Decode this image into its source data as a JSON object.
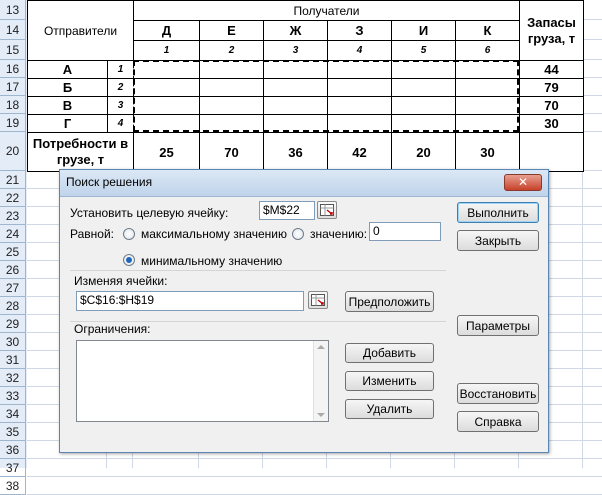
{
  "rows": [
    "13",
    "14",
    "15",
    "16",
    "17",
    "18",
    "19",
    "20",
    "21",
    "22",
    "23",
    "24",
    "25",
    "26",
    "27",
    "28",
    "29",
    "30",
    "31",
    "32",
    "33",
    "34",
    "35",
    "36",
    "37",
    "38"
  ],
  "table": {
    "senders_header": "Отправители",
    "receivers_header": "Получатели",
    "receivers": [
      "Д",
      "Е",
      "Ж",
      "З",
      "И",
      "К"
    ],
    "receiver_numbers": [
      "1",
      "2",
      "3",
      "4",
      "5",
      "6"
    ],
    "stock_header": "Запасы груза, т",
    "senders": [
      {
        "name": "А",
        "num": "1",
        "stock": "44"
      },
      {
        "name": "Б",
        "num": "2",
        "stock": "79"
      },
      {
        "name": "В",
        "num": "3",
        "stock": "70"
      },
      {
        "name": "Г",
        "num": "4",
        "stock": "30"
      }
    ],
    "demand_label": "Потребности в грузе, т",
    "demand": [
      "25",
      "70",
      "36",
      "42",
      "20",
      "30"
    ]
  },
  "dialog": {
    "title": "Поиск решения",
    "close_label": "✕",
    "target_label": "Установить целевую ячейку:",
    "target_value": "$M$22",
    "equal_label": "Равной:",
    "max_label": "максимальному значению",
    "value_label": "значению:",
    "value_value": "0",
    "min_label": "минимальному значению",
    "changing_label": "Изменяя ячейки:",
    "changing_value": "$C$16:$H$19",
    "guess_label": "Предположить",
    "constraints_label": "Ограничения:",
    "add_label": "Добавить",
    "change_label": "Изменить",
    "delete_label": "Удалить",
    "run_label": "Выполнить",
    "close_btn_label": "Закрыть",
    "params_label": "Параметры",
    "restore_label": "Восстановить",
    "help_label": "Справка",
    "selected_mode": "min"
  },
  "icons": {
    "close": "close-icon",
    "refedit": "range-select-icon",
    "scroll_up": "arrow-up-icon",
    "scroll_down": "arrow-down-icon"
  }
}
